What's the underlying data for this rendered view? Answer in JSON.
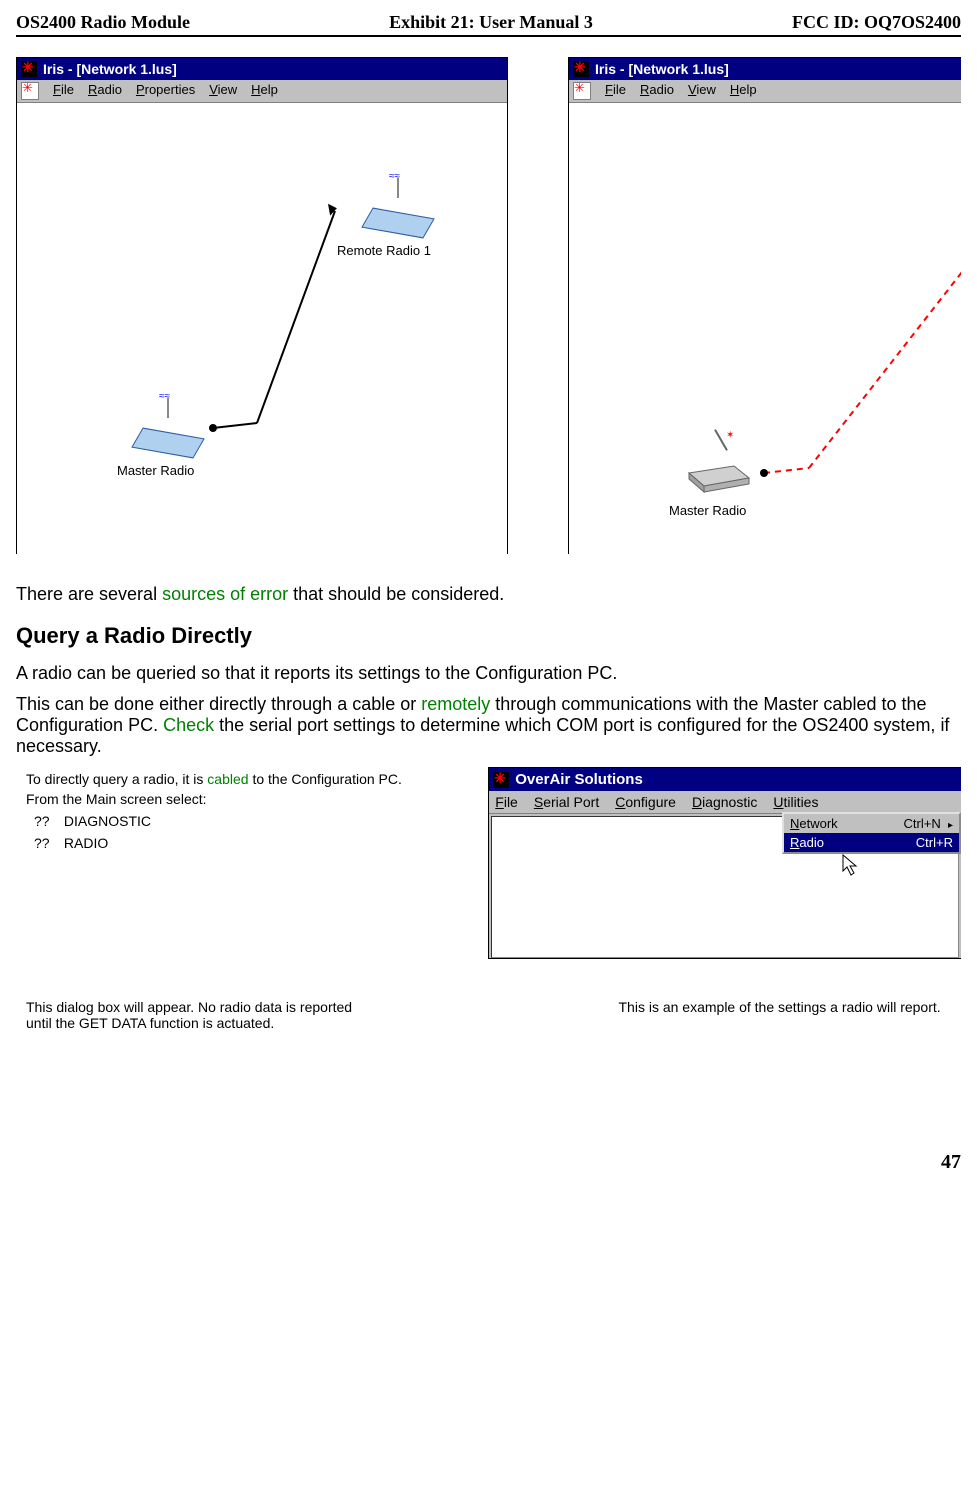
{
  "header": {
    "left": "OS2400 Radio Module",
    "center": "Exhibit 21: User Manual 3",
    "right": "FCC ID: OQ7OS2400"
  },
  "screenshot1": {
    "title": "Iris - [Network 1.lus]",
    "menu": [
      "File",
      "Radio",
      "Properties",
      "View",
      "Help"
    ],
    "remote_label": "Remote Radio 1",
    "master_label": "Master Radio"
  },
  "screenshot2": {
    "title": "Iris - [Network 1.lus]",
    "menu": [
      "File",
      "Radio",
      "View",
      "Help"
    ],
    "master_label": "Master Radio"
  },
  "text": {
    "intro_pre": "There are several ",
    "intro_link": "sources of error",
    "intro_post": " that should be considered.",
    "h2": "Query a Radio Directly",
    "p1": "A radio can be queried so that it reports its settings to the Configuration PC.",
    "p2_a": "This can be done either directly through a cable or ",
    "p2_link1": "remotely",
    "p2_b": " through communications with the Master cabled to the Configuration PC.  ",
    "p2_link2": "Check",
    "p2_c": " the serial port settings to determine which COM port is configured for the OS2400 system, if necessary."
  },
  "instructions": {
    "line1_a": "To directly query a radio, it is ",
    "line1_link": "cabled",
    "line1_b": " to the Configuration PC.",
    "line2": "From the Main screen select:",
    "bullet_marker": "??",
    "bullets": [
      "DIAGNOSTIC",
      "RADIO"
    ]
  },
  "diag": {
    "title": "OverAir Solutions",
    "menu": [
      "File",
      "Serial Port",
      "Configure",
      "Diagnostic",
      "Utilities"
    ],
    "dropdown": [
      {
        "label": "Network",
        "shortcut": "Ctrl+N",
        "arrow": "▸"
      },
      {
        "label": "Radio",
        "shortcut": "Ctrl+R",
        "arrow": ""
      }
    ]
  },
  "notes": {
    "left": "This dialog box will appear.  No radio data is reported until the GET DATA function is actuated.",
    "right": "This is an example of the settings a radio will report."
  },
  "page_number": "47"
}
